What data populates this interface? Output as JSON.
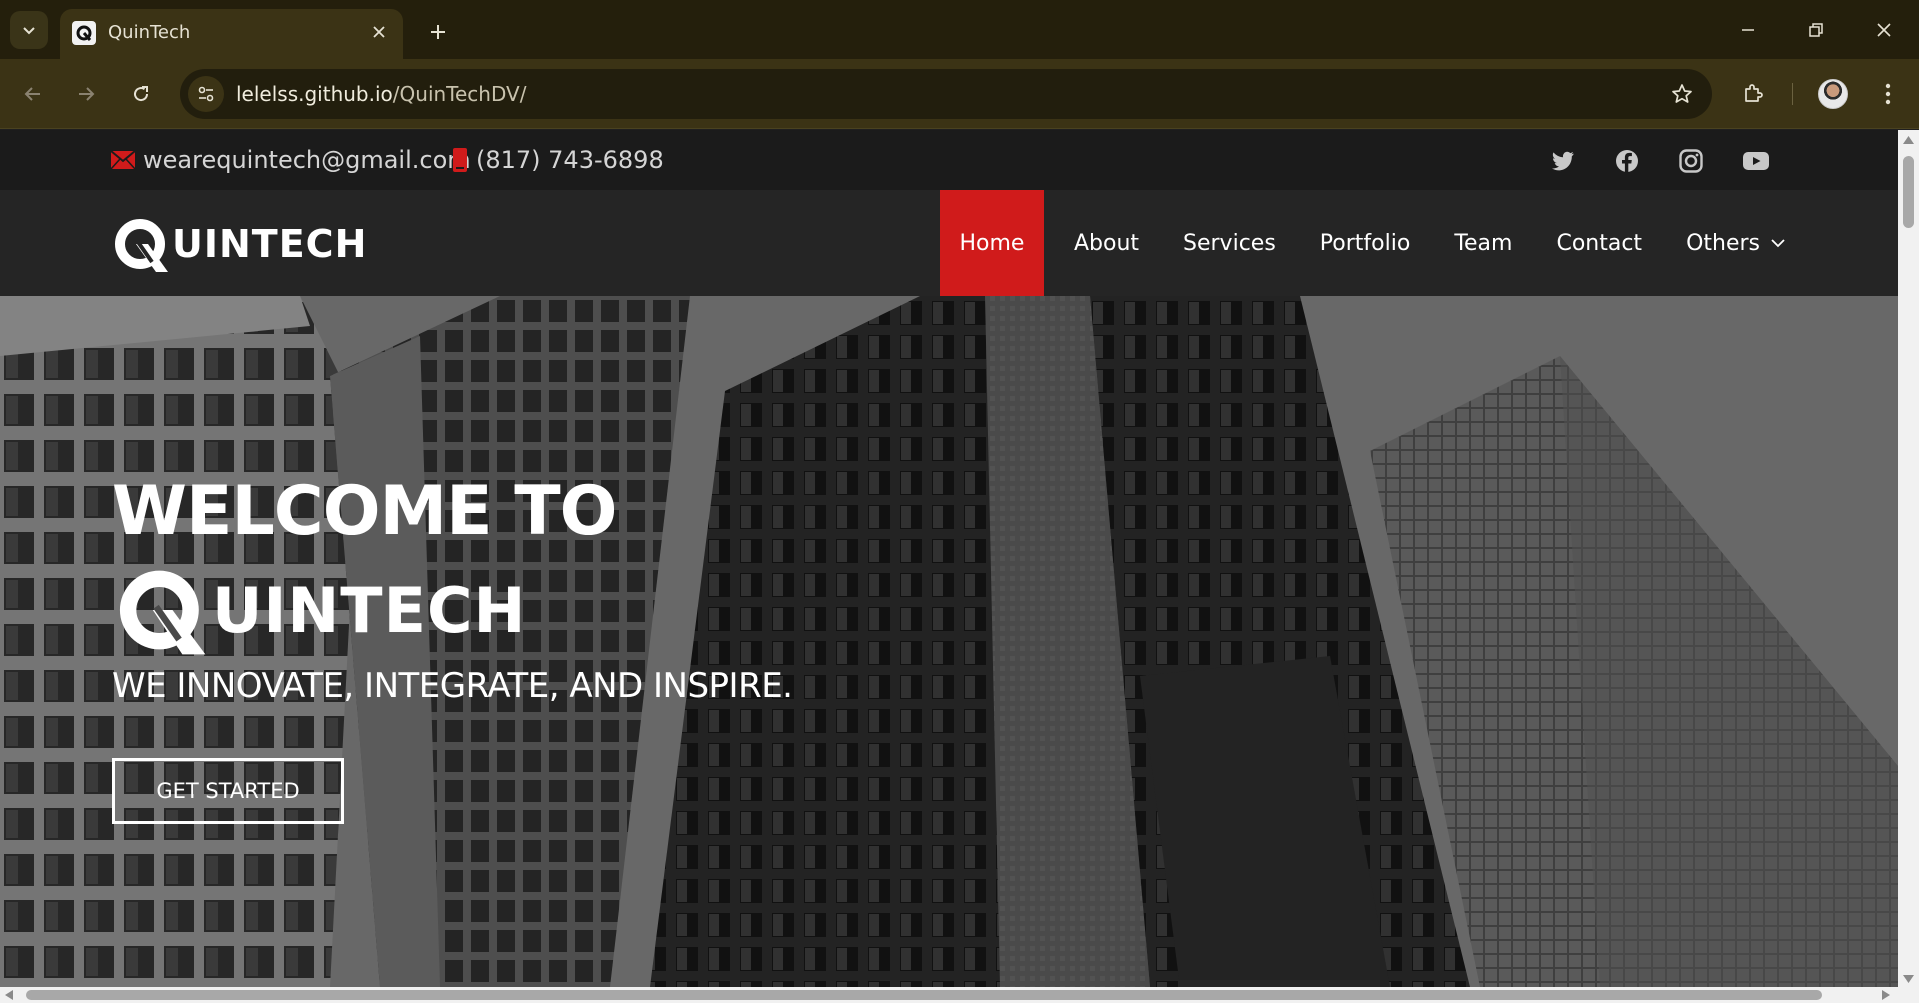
{
  "browser": {
    "tab_title": "QuinTech",
    "url_host": "lelelss.github.io",
    "url_path": "/QuinTechDV/",
    "colors": {
      "frame": "#241f0c",
      "toolbar": "#3b3315",
      "omnibox": "#221e0d"
    }
  },
  "topbar": {
    "email": "wearequintech@gmail.com",
    "phone": "(817) 743-6898",
    "social": [
      "twitter-icon",
      "facebook-icon",
      "instagram-icon",
      "youtube-icon"
    ]
  },
  "header": {
    "logo_text": "UINTECH",
    "nav": [
      {
        "label": "Home",
        "active": true
      },
      {
        "label": "About",
        "active": false
      },
      {
        "label": "Services",
        "active": false
      },
      {
        "label": "Portfolio",
        "active": false
      },
      {
        "label": "Team",
        "active": false
      },
      {
        "label": "Contact",
        "active": false
      },
      {
        "label": "Others",
        "active": false,
        "dropdown": true
      }
    ],
    "accent": "#d01b1b"
  },
  "hero": {
    "welcome": "WELCOME TO",
    "logo_text": "UINTECH",
    "tagline": "WE INNOVATE, INTEGRATE, AND INSPIRE.",
    "cta": "GET STARTED"
  }
}
